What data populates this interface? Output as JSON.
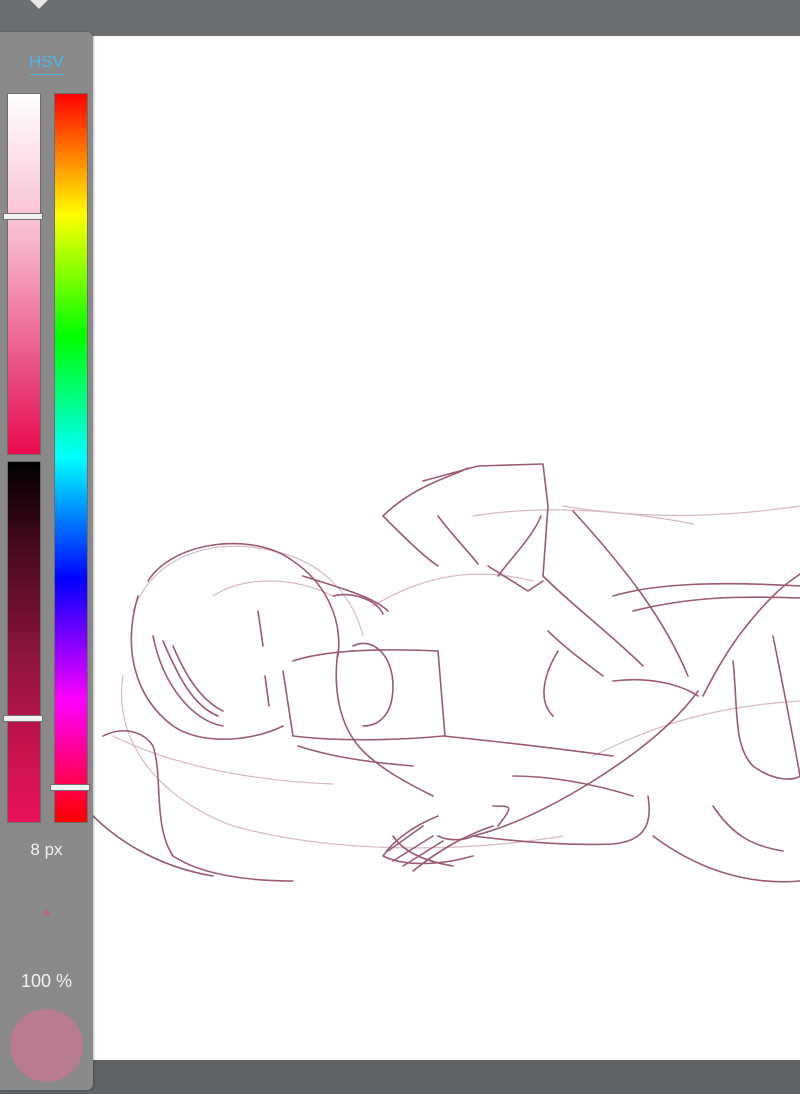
{
  "color_panel": {
    "mode_label": "HSV",
    "brush_size_label": "8 px",
    "opacity_label": "100 %",
    "current_color": "#b87b91",
    "sliders": {
      "saturation_level": 0.34,
      "value_level": 0.71,
      "hue_level": 0.95
    }
  },
  "canvas": {
    "background": "#ffffff",
    "stroke_color": "#9c5a76",
    "light_stroke_color": "#d8b8c6"
  },
  "icons": {
    "top_handle": "diamond-handle-icon",
    "size_preview": "brush-size-dot-icon"
  }
}
